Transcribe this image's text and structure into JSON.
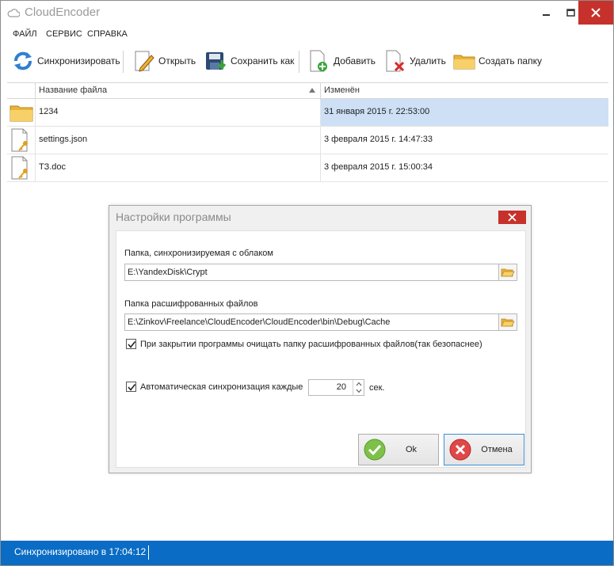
{
  "window": {
    "title": "CloudEncoder"
  },
  "menu": [
    "ФАЙЛ",
    "СЕРВИС",
    "СПРАВКА"
  ],
  "toolbar": {
    "sync": "Синхронизировать",
    "open": "Открыть",
    "save_as": "Сохранить как",
    "add": "Добавить",
    "delete": "Удалить",
    "create_folder": "Создать папку"
  },
  "grid": {
    "columns": [
      "Название файла",
      "Изменён"
    ],
    "rows": [
      {
        "icon": "folder-icon",
        "name": "1234",
        "modified": "31 января 2015 г. 22:53:00",
        "selected": true
      },
      {
        "icon": "encrypted-file-icon",
        "name": "settings.json",
        "modified": "3 февраля 2015 г. 14:47:33",
        "selected": false
      },
      {
        "icon": "encrypted-file-icon",
        "name": "ТЗ.doc",
        "modified": "3 февраля 2015 г. 15:00:34",
        "selected": false
      }
    ]
  },
  "dialog": {
    "title": "Настройки программы",
    "sync_folder_label": "Папка, синхронизируемая с облаком",
    "sync_folder_value": "E:\\YandexDisk\\Crypt",
    "decrypted_folder_label": "Папка расшифрованных файлов",
    "decrypted_folder_value": "E:\\Zinkov\\Freelance\\CloudEncoder\\CloudEncoder\\bin\\Debug\\Cache",
    "clear_on_exit_label": "При закрытии программы очищать папку расшифрованных файлов(так безопаснее)",
    "clear_on_exit_checked": true,
    "auto_sync_label": "Автоматическая синхронизация каждые",
    "auto_sync_checked": true,
    "auto_sync_interval": "20",
    "auto_sync_unit": "сек.",
    "ok_label": "Ok",
    "cancel_label": "Отмена"
  },
  "status": {
    "text": "Синхронизировано в 17:04:12"
  },
  "colors": {
    "accent": "#0a6cc4",
    "close_red": "#c7312b",
    "selection": "#cde0f5"
  }
}
